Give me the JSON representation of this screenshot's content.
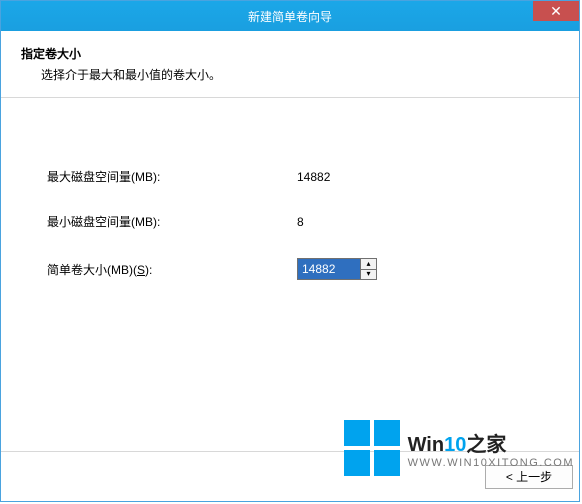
{
  "titlebar": {
    "title": "新建简单卷向导",
    "close_label": "✕"
  },
  "header": {
    "heading": "指定卷大小",
    "subheading": "选择介于最大和最小值的卷大小。"
  },
  "fields": {
    "max_label": "最大磁盘空间量(MB):",
    "max_value": "14882",
    "min_label": "最小磁盘空间量(MB):",
    "min_value": "8",
    "size_label_prefix": "简单卷大小(MB)(",
    "size_hotkey": "S",
    "size_label_suffix": "):",
    "size_value": "14882",
    "spin_up": "▴",
    "spin_down": "▾"
  },
  "footer": {
    "back_label": "< 上一步"
  },
  "watermark": {
    "brand_prefix": "Win",
    "brand_accent": "10",
    "brand_suffix": "之家",
    "sub": "WWW.WIN10XITONG.COM"
  },
  "colors": {
    "accent": "#1ba7e8",
    "close": "#c8504f",
    "logo": "#00a3ee"
  }
}
